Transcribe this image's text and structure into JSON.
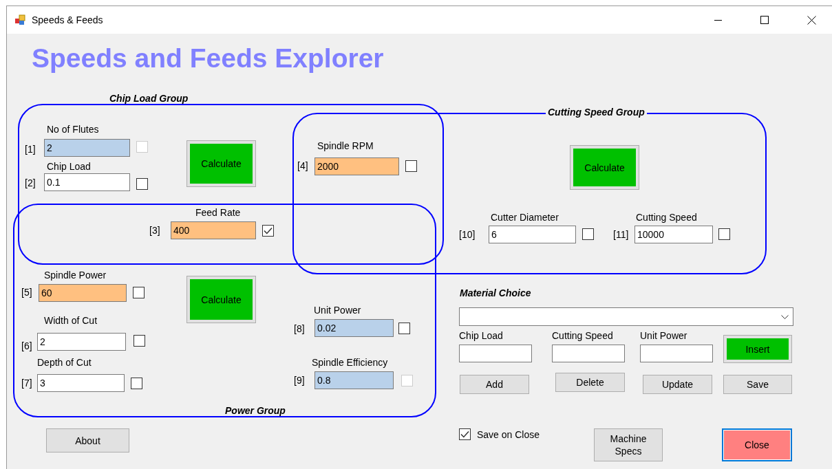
{
  "window": {
    "title": "Speeds & Feeds"
  },
  "heading": "Speeds and Feeds Explorer",
  "groups": [
    {
      "title": "Chip Load Group",
      "fields": [
        {
          "index": "[1]",
          "label": "No of Flutes",
          "value": "2",
          "kind": "fixed",
          "checked": false,
          "disabled": true
        },
        {
          "index": "[2]",
          "label": "Chip Load",
          "value": "0.1",
          "kind": "input",
          "checked": false,
          "disabled": false
        },
        {
          "index": "[3]",
          "label": "Feed Rate",
          "value": "400",
          "kind": "target",
          "checked": true,
          "disabled": false
        }
      ],
      "button": "Calculate"
    },
    {
      "title": "Cutting Speed Group",
      "fields": [
        {
          "index": "[4]",
          "label": "Spindle RPM",
          "value": "2000",
          "kind": "target",
          "checked": false,
          "disabled": false
        },
        {
          "index": "[10]",
          "label": "Cutter Diameter",
          "value": "6",
          "kind": "input",
          "checked": false,
          "disabled": false
        },
        {
          "index": "[11]",
          "label": "Cutting Speed",
          "value": "10000",
          "kind": "input",
          "checked": false,
          "disabled": false
        }
      ],
      "button": "Calculate"
    },
    {
      "title": "Power Group",
      "fields": [
        {
          "index": "[5]",
          "label": "Spindle Power",
          "value": "60",
          "kind": "target",
          "checked": false,
          "disabled": false
        },
        {
          "index": "[6]",
          "label": "Width of Cut",
          "value": "2",
          "kind": "input",
          "checked": false,
          "disabled": false
        },
        {
          "index": "[7]",
          "label": "Depth of Cut",
          "value": "3",
          "kind": "input",
          "checked": false,
          "disabled": false
        },
        {
          "index": "[8]",
          "label": "Unit Power",
          "value": "0.02",
          "kind": "fixed",
          "checked": false,
          "disabled": false
        },
        {
          "index": "[9]",
          "label": "Spindle Efficiency",
          "value": "0.8",
          "kind": "fixed",
          "checked": false,
          "disabled": true
        }
      ],
      "button": "Calculate"
    }
  ],
  "material": {
    "title": "Material Choice",
    "fields": [
      {
        "label": "Chip Load"
      },
      {
        "label": "Cutting Speed"
      },
      {
        "label": "Unit Power"
      }
    ],
    "buttons": [
      {
        "label": "Insert",
        "kind": "go"
      },
      {
        "label": "Add",
        "kind": "plain"
      },
      {
        "label": "Delete",
        "kind": "plain"
      },
      {
        "label": "Update",
        "kind": "plain"
      },
      {
        "label": "Save",
        "kind": "plain"
      }
    ]
  },
  "save_on_close": {
    "label": "Save on Close",
    "checked": true
  },
  "footer_buttons": [
    {
      "label": "About",
      "kind": "plain"
    },
    {
      "label": "Machine Specs",
      "kind": "plain"
    },
    {
      "label": "Close",
      "kind": "danger"
    }
  ]
}
